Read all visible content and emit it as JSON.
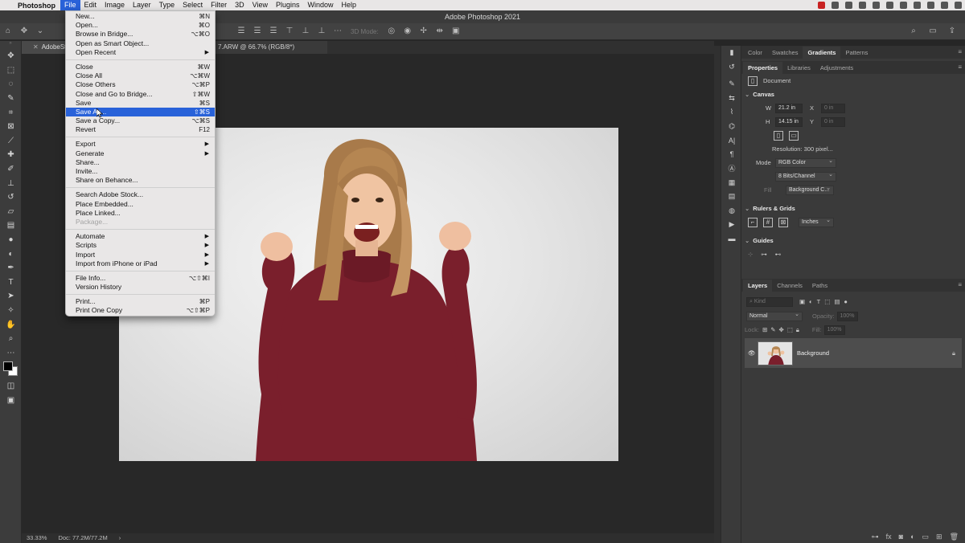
{
  "menubar": {
    "app_name": "Photoshop",
    "items": [
      "File",
      "Edit",
      "Image",
      "Layer",
      "Type",
      "Select",
      "Filter",
      "3D",
      "View",
      "Plugins",
      "Window",
      "Help"
    ],
    "active_item": "File"
  },
  "window": {
    "title": "Adobe Photoshop 2021"
  },
  "options_bar": {
    "mode_3d_label": "3D Mode:"
  },
  "document": {
    "tab_label": "AdobeStock",
    "tab_tail": "7.ARW @ 66.7% (RGB/8*)"
  },
  "file_menu": {
    "groups": [
      [
        {
          "label": "New...",
          "shortcut": "⌘N"
        },
        {
          "label": "Open...",
          "shortcut": "⌘O"
        },
        {
          "label": "Browse in Bridge...",
          "shortcut": "⌥⌘O"
        },
        {
          "label": "Open as Smart Object...",
          "shortcut": ""
        },
        {
          "label": "Open Recent",
          "shortcut": "",
          "submenu": true
        }
      ],
      [
        {
          "label": "Close",
          "shortcut": "⌘W"
        },
        {
          "label": "Close All",
          "shortcut": "⌥⌘W"
        },
        {
          "label": "Close Others",
          "shortcut": "⌥⌘P"
        },
        {
          "label": "Close and Go to Bridge...",
          "shortcut": "⇧⌘W"
        },
        {
          "label": "Save",
          "shortcut": "⌘S"
        },
        {
          "label": "Save As...",
          "shortcut": "⇧⌘S",
          "highlighted": true
        },
        {
          "label": "Save a Copy...",
          "shortcut": "⌥⌘S"
        },
        {
          "label": "Revert",
          "shortcut": "F12"
        }
      ],
      [
        {
          "label": "Export",
          "shortcut": "",
          "submenu": true
        },
        {
          "label": "Generate",
          "shortcut": "",
          "submenu": true
        },
        {
          "label": "Share...",
          "shortcut": ""
        },
        {
          "label": "Invite...",
          "shortcut": ""
        },
        {
          "label": "Share on Behance...",
          "shortcut": ""
        }
      ],
      [
        {
          "label": "Search Adobe Stock...",
          "shortcut": ""
        },
        {
          "label": "Place Embedded...",
          "shortcut": ""
        },
        {
          "label": "Place Linked...",
          "shortcut": ""
        },
        {
          "label": "Package...",
          "shortcut": "",
          "disabled": true
        }
      ],
      [
        {
          "label": "Automate",
          "shortcut": "",
          "submenu": true
        },
        {
          "label": "Scripts",
          "shortcut": "",
          "submenu": true
        },
        {
          "label": "Import",
          "shortcut": "",
          "submenu": true
        },
        {
          "label": "Import from iPhone or iPad",
          "shortcut": "",
          "submenu": true
        }
      ],
      [
        {
          "label": "File Info...",
          "shortcut": "⌥⇧⌘I"
        },
        {
          "label": "Version History",
          "shortcut": ""
        }
      ],
      [
        {
          "label": "Print...",
          "shortcut": "⌘P"
        },
        {
          "label": "Print One Copy",
          "shortcut": "⌥⇧⌘P"
        }
      ]
    ]
  },
  "status_bar": {
    "zoom": "33.33%",
    "doc_size": "Doc: 77.2M/77.2M",
    "arrow": "›"
  },
  "top_panel": {
    "tabs": [
      "Color",
      "Swatches",
      "Gradients",
      "Patterns"
    ],
    "active_tab": "Gradients"
  },
  "properties_panel": {
    "tabs": [
      "Properties",
      "Libraries",
      "Adjustments"
    ],
    "active_tab": "Properties",
    "doc_label": "Document",
    "canvas": {
      "title": "Canvas",
      "w_label": "W",
      "w_value": "21.2 in",
      "x_label": "X",
      "x_value": "0 in",
      "h_label": "H",
      "h_value": "14.15 in",
      "y_label": "Y",
      "y_value": "0 in",
      "resolution": "Resolution: 300 pixel...",
      "mode_label": "Mode",
      "mode_value": "RGB Color",
      "bits_value": "8 Bits/Channel",
      "fill_label": "Fill",
      "fill_value": "Background C..."
    },
    "rulers": {
      "title": "Rulers & Grids",
      "units": "Inches"
    },
    "guides": {
      "title": "Guides"
    }
  },
  "layers_panel": {
    "tabs": [
      "Layers",
      "Channels",
      "Paths"
    ],
    "active_tab": "Layers",
    "kind_label": "Kind",
    "blend_mode": "Normal",
    "opacity_label": "Opacity:",
    "opacity_value": "100%",
    "lock_label": "Lock:",
    "fill_label": "Fill:",
    "fill_value": "100%",
    "layers": [
      {
        "name": "Background",
        "visible": true,
        "locked": true
      }
    ]
  },
  "colors": {
    "accent": "#2962d9",
    "sweater": "#7a1f2c",
    "hair": "#b58652"
  }
}
